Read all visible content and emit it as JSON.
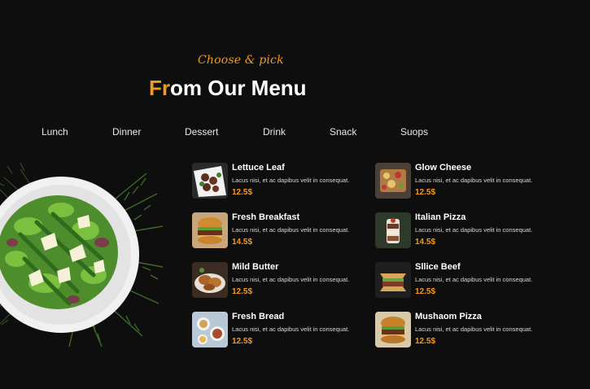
{
  "header": {
    "tagline": "Choose & pick",
    "title_accent": "Fr",
    "title_rest": "om Our Menu"
  },
  "tabs": [
    "Lunch",
    "Dinner",
    "Dessert",
    "Drink",
    "Snack",
    "Suops"
  ],
  "menu": {
    "left": [
      {
        "name": "Lettuce Leaf",
        "desc": "Lacus nisi, et ac dapibus velit in consequat.",
        "price": "12.5$"
      },
      {
        "name": "Fresh Breakfast",
        "desc": "Lacus nisi, et ac dapibus velit in consequat.",
        "price": "14.5$"
      },
      {
        "name": "Mild Butter",
        "desc": "Lacus nisi, et ac dapibus velit in consequat.",
        "price": "12.5$"
      },
      {
        "name": "Fresh Bread",
        "desc": "Lacus nisi, et ac dapibus velit in consequat.",
        "price": "12.5$"
      }
    ],
    "right": [
      {
        "name": "Glow Cheese",
        "desc": "Lacus nisi, et ac dapibus velit in consequat.",
        "price": "12.5$"
      },
      {
        "name": "Italian Pizza",
        "desc": "Lacus nisi, et ac dapibus velit in consequat.",
        "price": "14.5$"
      },
      {
        "name": "Sllice Beef",
        "desc": "Lacus nisi, et ac dapibus velit in consequat.",
        "price": "12.5$"
      },
      {
        "name": "Mushaom Pizza",
        "desc": "Lacus nisi, et ac dapibus velit in consequat.",
        "price": "12.5$"
      }
    ]
  },
  "colors": {
    "accent": "#f39a1e",
    "background": "#0e0e0e"
  }
}
